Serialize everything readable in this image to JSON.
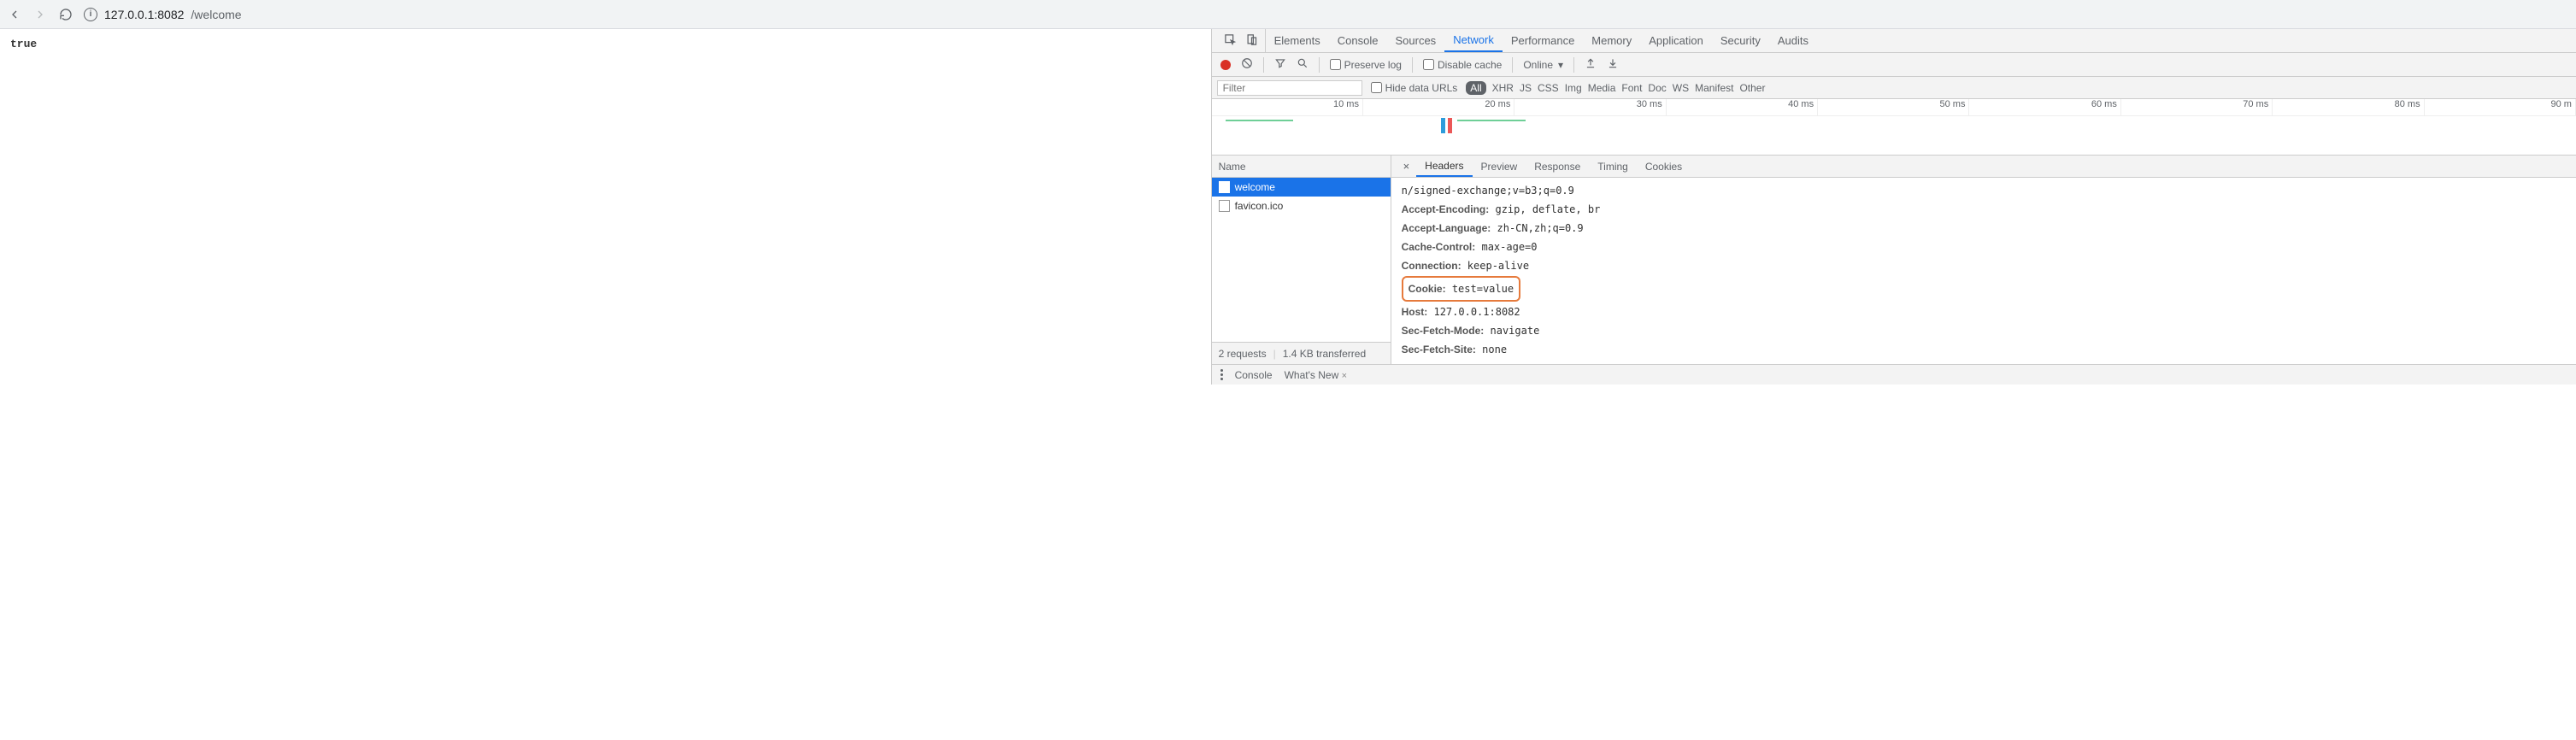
{
  "url": {
    "host": "127.0.0.1:8082",
    "path": "/welcome"
  },
  "page_body": "true",
  "devtools_tabs": [
    "Elements",
    "Console",
    "Sources",
    "Network",
    "Performance",
    "Memory",
    "Application",
    "Security",
    "Audits"
  ],
  "devtools_active_tab": "Network",
  "net_toolbar": {
    "preserve_log": "Preserve log",
    "disable_cache": "Disable cache",
    "throttling": "Online"
  },
  "filter": {
    "placeholder": "Filter",
    "hide_data_urls": "Hide data URLs",
    "types": [
      "All",
      "XHR",
      "JS",
      "CSS",
      "Img",
      "Media",
      "Font",
      "Doc",
      "WS",
      "Manifest",
      "Other"
    ]
  },
  "timeline_ticks": [
    "10 ms",
    "20 ms",
    "30 ms",
    "40 ms",
    "50 ms",
    "60 ms",
    "70 ms",
    "80 ms",
    "90 m"
  ],
  "name_header": "Name",
  "requests": [
    {
      "name": "welcome",
      "selected": true
    },
    {
      "name": "favicon.ico",
      "selected": false
    }
  ],
  "footer": {
    "requests": "2 requests",
    "transferred": "1.4 KB transferred"
  },
  "detail_tabs": [
    "Headers",
    "Preview",
    "Response",
    "Timing",
    "Cookies"
  ],
  "headers": [
    {
      "k": "",
      "v": "n/signed-exchange;v=b3;q=0.9"
    },
    {
      "k": "Accept-Encoding:",
      "v": "gzip, deflate, br"
    },
    {
      "k": "Accept-Language:",
      "v": "zh-CN,zh;q=0.9"
    },
    {
      "k": "Cache-Control:",
      "v": "max-age=0"
    },
    {
      "k": "Connection:",
      "v": "keep-alive"
    },
    {
      "k": "Cookie:",
      "v": "test=value",
      "hl": true
    },
    {
      "k": "Host:",
      "v": "127.0.0.1:8082"
    },
    {
      "k": "Sec-Fetch-Mode:",
      "v": "navigate"
    },
    {
      "k": "Sec-Fetch-Site:",
      "v": "none"
    }
  ],
  "drawer": {
    "console": "Console",
    "whatsnew": "What's New"
  }
}
